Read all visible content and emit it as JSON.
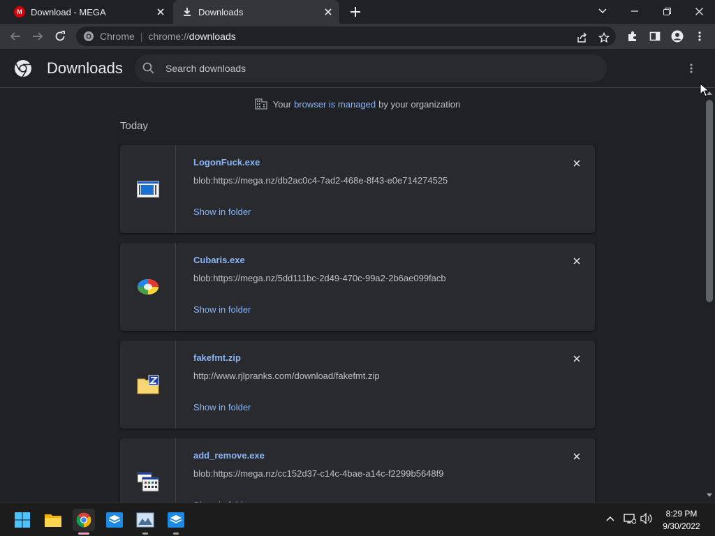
{
  "tabs": [
    {
      "title": "Download - MEGA",
      "favicon": "mega-logo-icon",
      "active": false
    },
    {
      "title": "Downloads",
      "favicon": "download-icon",
      "active": true
    }
  ],
  "omnibox": {
    "site_name": "Chrome",
    "url_scheme": "chrome://",
    "url_path": "downloads"
  },
  "downloads_page": {
    "title": "Downloads",
    "search_placeholder": "Search downloads",
    "managed_notice": {
      "before": "Your",
      "link": "browser is managed",
      "after": "by your organization"
    },
    "section_label": "Today",
    "show_in_folder_label": "Show in folder",
    "items": [
      {
        "name": "LogonFuck.exe",
        "url": "blob:https://mega.nz/db2ac0c4-7ad2-468e-8f43-e0e714274525",
        "icon": "window-app-icon"
      },
      {
        "name": "Cubaris.exe",
        "url": "blob:https://mega.nz/5dd111bc-2d49-470c-99a2-2b6ae099facb",
        "icon": "color-sphere-icon"
      },
      {
        "name": "fakefmt.zip",
        "url": "http://www.rjlpranks.com/download/fakefmt.zip",
        "icon": "zip-folder-icon"
      },
      {
        "name": "add_remove.exe",
        "url": "blob:https://mega.nz/cc152d37-c14c-4bae-a14c-f2299b5648f9",
        "icon": "installer-icon"
      }
    ]
  },
  "taskbar": {
    "apps": [
      "windows-start-icon",
      "file-explorer-icon",
      "chrome-icon",
      "app-box-icon",
      "image-viewer-icon",
      "app-box-2-icon"
    ],
    "time": "8:29 PM",
    "date": "9/30/2022"
  },
  "colors": {
    "accent_link": "#8ab4f8",
    "page_bg": "#202124",
    "card_bg": "#292a2d",
    "toolbar_bg": "#35363a"
  }
}
